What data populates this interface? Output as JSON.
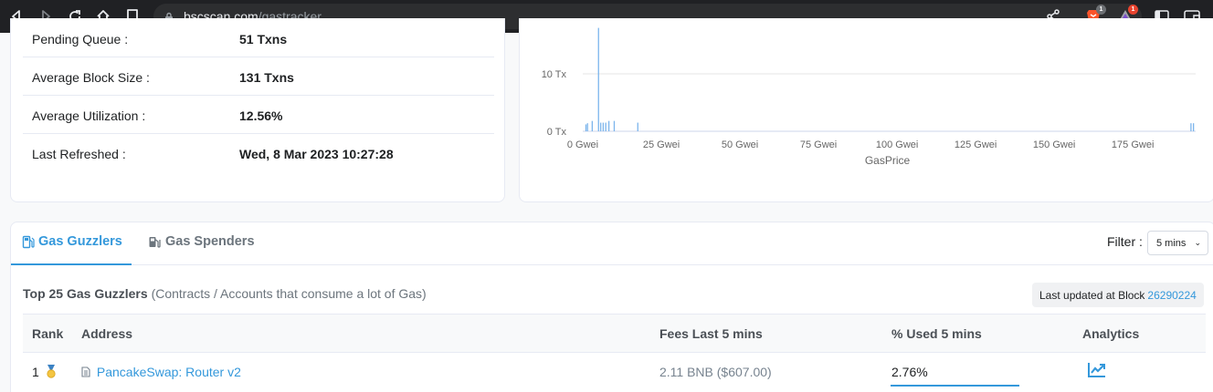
{
  "browser": {
    "url_domain": "bscscan.com",
    "url_path": "/gastracker",
    "brave_badge": "1",
    "rewards_badge": "1"
  },
  "stats": [
    {
      "label": "Pending Queue :",
      "value": "51 Txns"
    },
    {
      "label": "Average Block Size :",
      "value": "131 Txns"
    },
    {
      "label": "Average Utilization :",
      "value": "12.56%"
    },
    {
      "label": "Last Refreshed :",
      "value": "Wed, 8 Mar 2023 10:27:28"
    }
  ],
  "chart_data": {
    "type": "bar",
    "xlabel": "GasPrice",
    "ylabel": "",
    "x_ticks": [
      "0 Gwei",
      "25 Gwei",
      "50 Gwei",
      "75 Gwei",
      "100 Gwei",
      "125 Gwei",
      "150 Gwei",
      "175 Gwei"
    ],
    "y_ticks": [
      "0 Tx",
      "10 Tx"
    ],
    "xlim": [
      0,
      195
    ],
    "ylim": [
      0,
      10
    ],
    "bars": [
      {
        "x": 1,
        "y": 1.2
      },
      {
        "x": 1.5,
        "y": 1.4
      },
      {
        "x": 3,
        "y": 1.8
      },
      {
        "x": 5,
        "y": 18
      },
      {
        "x": 5.7,
        "y": 1.5
      },
      {
        "x": 6.5,
        "y": 1.5
      },
      {
        "x": 7.3,
        "y": 1.5
      },
      {
        "x": 8.3,
        "y": 1.8
      },
      {
        "x": 10,
        "y": 1.8
      },
      {
        "x": 17.5,
        "y": 1.5
      },
      {
        "x": 193.5,
        "y": 1.4
      },
      {
        "x": 194.3,
        "y": 1.4
      }
    ]
  },
  "tabs": [
    {
      "label": "Gas Guzzlers"
    },
    {
      "label": "Gas Spenders"
    }
  ],
  "filter": {
    "label": "Filter :",
    "value": "5 mins"
  },
  "section": {
    "title": "Top 25 Gas Guzzlers",
    "subtitle": "(Contracts / Accounts that consume a lot of Gas)",
    "last_updated_label": "Last updated at Block",
    "last_updated_block": "26290224"
  },
  "table": {
    "headers": [
      "Rank",
      "Address",
      "Fees Last 5 mins",
      "% Used 5 mins",
      "Analytics"
    ],
    "rows": [
      {
        "rank": "1",
        "address": "PancakeSwap: Router v2",
        "fees": "2.11 BNB ($607.00)",
        "used": "2.76%"
      }
    ]
  }
}
